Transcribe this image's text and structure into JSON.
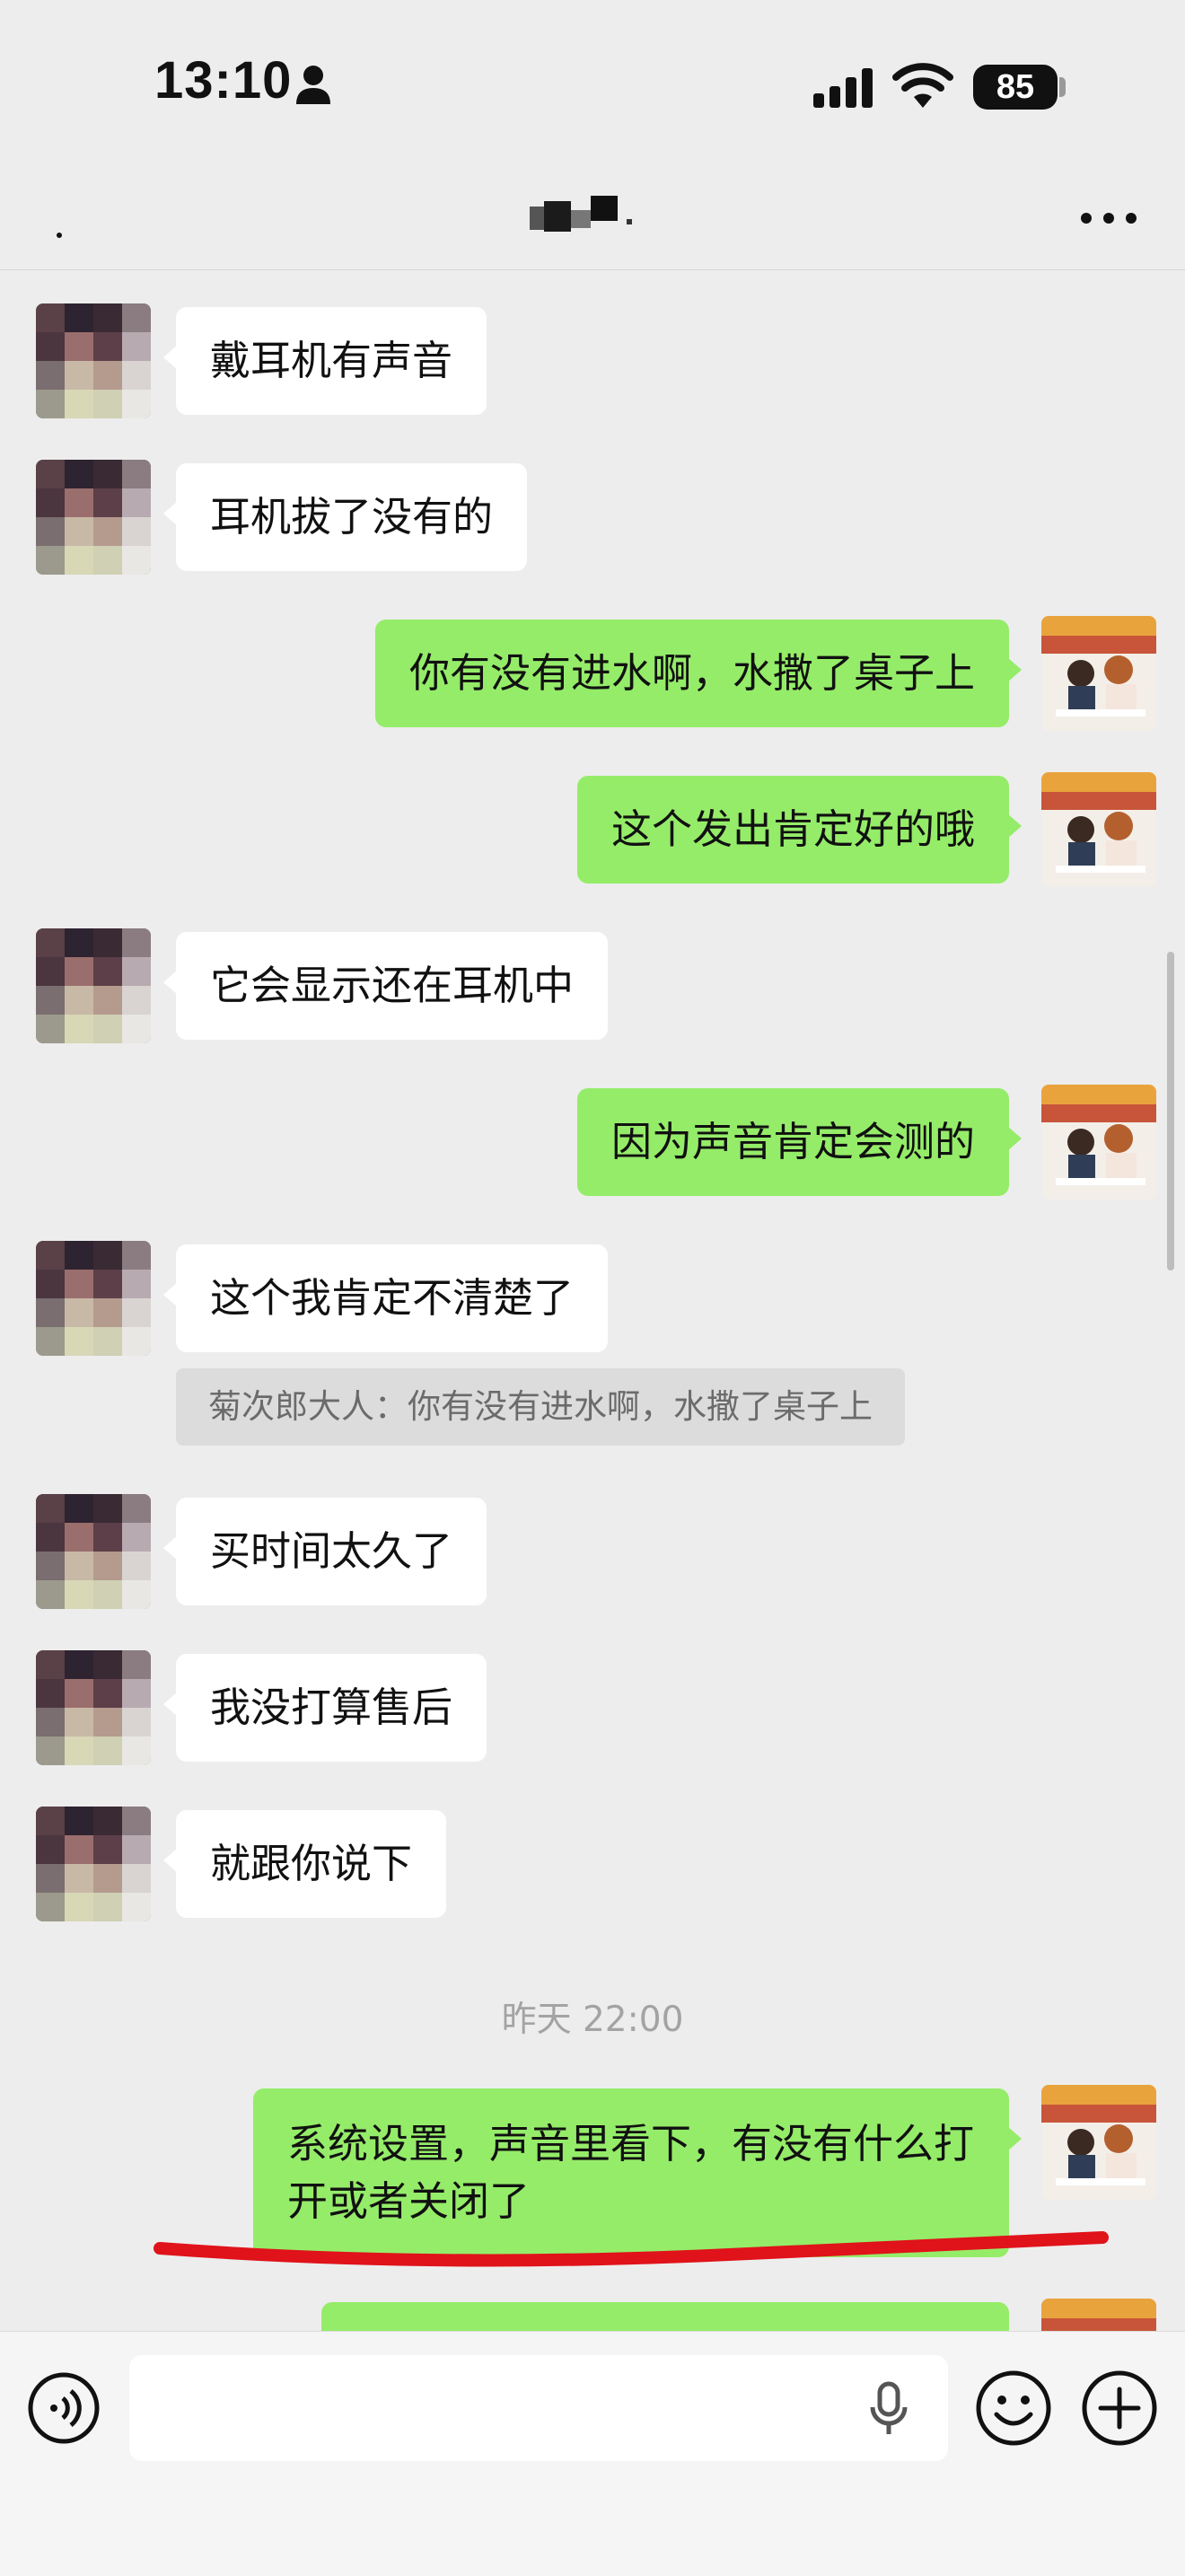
{
  "status_bar": {
    "time": "13:10",
    "battery": "85"
  },
  "chat": {
    "title": "",
    "messages": [
      {
        "id": "m1",
        "sender": "them",
        "text": "戴耳机有声音"
      },
      {
        "id": "m2",
        "sender": "them",
        "text": "耳机拔了没有的"
      },
      {
        "id": "m3",
        "sender": "me",
        "text": "你有没有进水啊，水撒了桌子上"
      },
      {
        "id": "m4",
        "sender": "me",
        "text": "这个发出肯定好的哦"
      },
      {
        "id": "m5",
        "sender": "them",
        "text": "它会显示还在耳机中"
      },
      {
        "id": "m6",
        "sender": "me",
        "text": "因为声音肯定会测的"
      },
      {
        "id": "m7",
        "sender": "them",
        "text": "这个我肯定不清楚了",
        "quote": "菊次郎大人：你有没有进水啊，水撒了桌子上"
      },
      {
        "id": "m8",
        "sender": "them",
        "text": "买时间太久了"
      },
      {
        "id": "m9",
        "sender": "them",
        "text": "我没打算售后"
      },
      {
        "id": "m10",
        "sender": "them",
        "text": "就跟你说下"
      },
      {
        "id": "m11",
        "sender": "me",
        "text": "系统设置，声音里看下，有没有什么打开或者关闭了"
      },
      {
        "id": "m12",
        "sender": "me",
        "text": ""
      }
    ],
    "timestamp": "昨天 22:00"
  },
  "input_bar": {
    "placeholder": "",
    "value": ""
  },
  "colors": {
    "background": "#ededed",
    "bubble_me": "#95ec69",
    "bubble_them": "#ffffff",
    "annotation": "#e0121a"
  },
  "icons": {
    "status": [
      "person-icon",
      "signal-icon",
      "wifi-icon",
      "battery-icon"
    ],
    "nav": [
      "back-icon",
      "more-icon"
    ],
    "input": [
      "voice-icon",
      "mic-icon",
      "emoji-icon",
      "plus-icon"
    ]
  }
}
